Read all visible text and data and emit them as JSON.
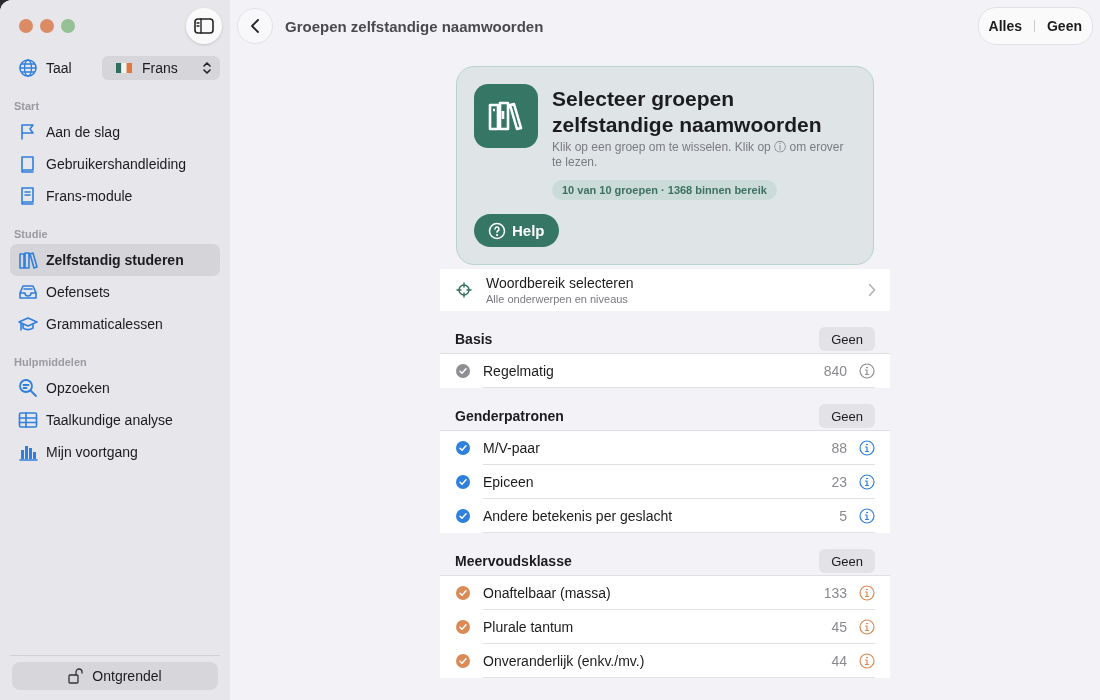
{
  "sidebar": {
    "language": {
      "label": "Taal",
      "value": "Frans"
    },
    "sections": [
      {
        "title": "Start",
        "items": [
          {
            "label": "Aan de slag",
            "selected": false
          },
          {
            "label": "Gebruikershandleiding",
            "selected": false
          },
          {
            "label": "Frans-module",
            "selected": false
          }
        ]
      },
      {
        "title": "Studie",
        "items": [
          {
            "label": "Zelfstandig studeren",
            "selected": true
          },
          {
            "label": "Oefensets",
            "selected": false
          },
          {
            "label": "Grammaticalessen",
            "selected": false
          }
        ]
      },
      {
        "title": "Hulpmiddelen",
        "items": [
          {
            "label": "Opzoeken",
            "selected": false
          },
          {
            "label": "Taalkundige analyse",
            "selected": false
          },
          {
            "label": "Mijn voortgang",
            "selected": false
          }
        ]
      }
    ],
    "unlock_button": "Ontgrendel"
  },
  "header": {
    "title": "Groepen zelfstandige naamwoorden",
    "all_button": "Alles",
    "none_button": "Geen"
  },
  "card": {
    "title": "Selecteer groepen zelfstandige naamwoorden",
    "subtitle": "Klik op een groep om te wisselen. Klik op ⓘ om erover te lezen.",
    "summary": "10 van 10 groepen · 1368 binnen bereik",
    "help_button": "Help"
  },
  "range": {
    "title": "Woordbereik selecteren",
    "subtitle": "Alle onderwerpen en niveaus"
  },
  "groups": [
    {
      "title": "Basis",
      "button": "Geen",
      "color": "#8e8e93",
      "items": [
        {
          "label": "Regelmatig",
          "count": "840",
          "checked": true
        }
      ]
    },
    {
      "title": "Genderpatronen",
      "button": "Geen",
      "color": "#2f7fdc",
      "items": [
        {
          "label": "M/V-paar",
          "count": "88",
          "checked": true
        },
        {
          "label": "Epiceen",
          "count": "23",
          "checked": true
        },
        {
          "label": "Andere betekenis per geslacht",
          "count": "5",
          "checked": true
        }
      ]
    },
    {
      "title": "Meervoudsklasse",
      "button": "Geen",
      "color": "#d98a55",
      "items": [
        {
          "label": "Onaftelbaar (massa)",
          "count": "133",
          "checked": true
        },
        {
          "label": "Plurale tantum",
          "count": "45",
          "checked": true
        },
        {
          "label": "Onveranderlijk (enkv./mv.)",
          "count": "44",
          "checked": true
        }
      ]
    }
  ]
}
